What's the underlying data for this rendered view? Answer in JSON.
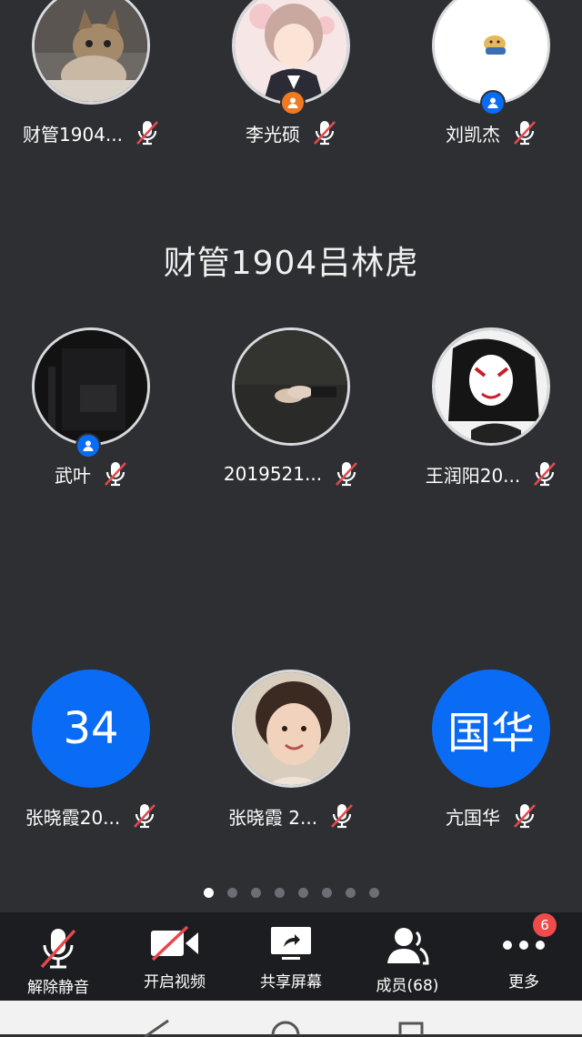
{
  "participants": [
    {
      "name": "财管1904...",
      "avatar": "cat-photo",
      "muted": true,
      "host_badge": false
    },
    {
      "name": "李光硕",
      "avatar": "anime-boy",
      "muted": true,
      "host_badge": "orange"
    },
    {
      "name": "刘凯杰",
      "avatar": "dog-sticker",
      "muted": true,
      "host_badge": "blue"
    },
    {
      "name": "武叶",
      "avatar": "dark-photo",
      "muted": false,
      "host_badge": "blue"
    },
    {
      "name": "2019521...",
      "avatar": "hands-photo",
      "muted": true,
      "host_badge": false
    },
    {
      "name": "王润阳20...",
      "avatar": "fox-mask-anime",
      "muted": true,
      "host_badge": false
    },
    {
      "name": "张晓霞20...",
      "avatar": "initials",
      "avatar_text": "34",
      "muted": true,
      "host_badge": false
    },
    {
      "name": "张晓霞 2...",
      "avatar": "child-photo",
      "muted": true,
      "host_badge": false
    },
    {
      "name": "亢国华",
      "avatar": "initials",
      "avatar_text": "国华",
      "muted": true,
      "host_badge": false
    }
  ],
  "active_speaker": "财管1904吕林虎",
  "pagination": {
    "pages": 8,
    "current": 1
  },
  "toolbar": {
    "unmute": "解除静音",
    "video": "开启视频",
    "share": "共享屏幕",
    "members": "成员(68)",
    "more": "更多",
    "more_badge": "6"
  },
  "colors": {
    "background": "#2d2f33",
    "toolbar": "#1c1d20",
    "accent_blue": "#0a6cf5",
    "host_orange": "#f07a21",
    "mute_red": "#e5484d",
    "badge_red": "#f04b4b"
  }
}
